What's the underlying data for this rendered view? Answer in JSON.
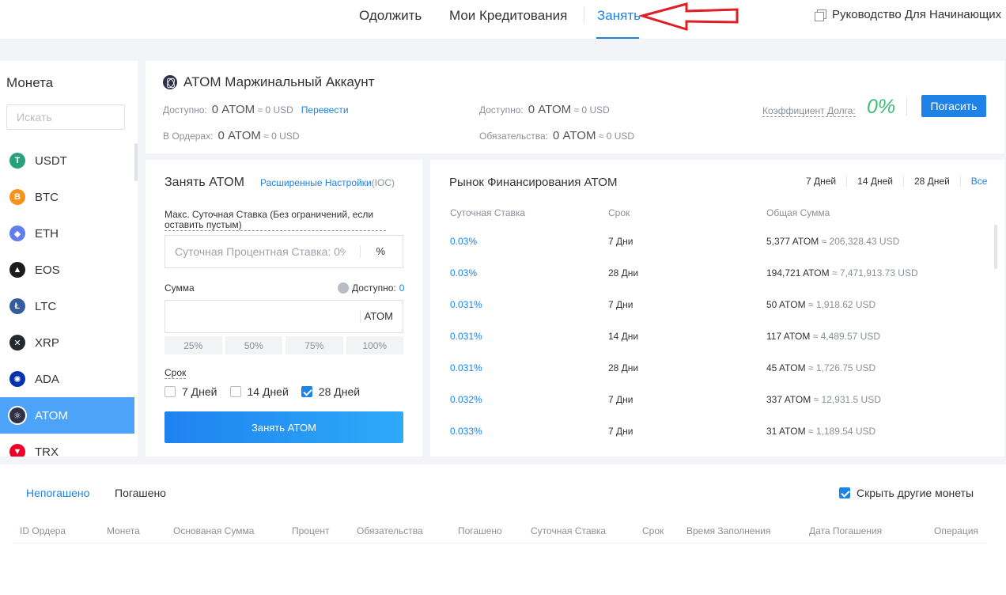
{
  "nav": {
    "tabs": [
      "Одолжить",
      "Мои Кредитования",
      "Занять"
    ],
    "guide": "Руководство Для Начинающих"
  },
  "sidebar": {
    "title": "Монета",
    "search_placeholder": "Искать",
    "coins": [
      {
        "name": "USDT",
        "color": "#26a17b",
        "glyph": "T"
      },
      {
        "name": "BTC",
        "color": "#f7931a",
        "glyph": "B"
      },
      {
        "name": "ETH",
        "color": "#627eea",
        "glyph": "◆"
      },
      {
        "name": "EOS",
        "color": "#1b1b1b",
        "glyph": "▲"
      },
      {
        "name": "LTC",
        "color": "#345d9d",
        "glyph": "Ł"
      },
      {
        "name": "XRP",
        "color": "#23292f",
        "glyph": "✕"
      },
      {
        "name": "ADA",
        "color": "#0033ad",
        "glyph": "✺"
      },
      {
        "name": "ATOM",
        "color": "#2e3148",
        "glyph": "⚛"
      },
      {
        "name": "TRX",
        "color": "#ef0027",
        "glyph": "▼"
      }
    ],
    "active": "ATOM"
  },
  "account": {
    "title": "ATOM Маржинальный Аккаунт",
    "available_label": "Доступно:",
    "available_value": "0 ATOM",
    "available_usd": "≈ 0 USD",
    "transfer": "Перевести",
    "in_orders_label": "В Ордерах:",
    "in_orders_value": "0 ATOM",
    "in_orders_usd": "≈ 0 USD",
    "available2_label": "Доступно:",
    "available2_value": "0 ATOM",
    "available2_usd": "≈ 0 USD",
    "liabilities_label": "Обязательства:",
    "liabilities_value": "0 ATOM",
    "liabilities_usd": "≈ 0 USD",
    "debt_ratio_label": "Коэффициент Долга:",
    "debt_ratio_value": "0%",
    "repay_button": "Погасить"
  },
  "borrow": {
    "title": "Занять ATOM",
    "advanced": "Расширенные Настройки",
    "advanced_suffix": "(IOC)",
    "max_rate_label": "Макс. Суточная Ставка (Без ограничений, если оставить пустым)",
    "rate_placeholder": "Суточная Процентная Ставка: 0%~",
    "rate_unit": "%",
    "amount_label": "Сумма",
    "available_label": "Доступно:",
    "available_value": "0",
    "amount_unit": "ATOM",
    "percents": [
      "25%",
      "50%",
      "75%",
      "100%"
    ],
    "term_label": "Срок",
    "terms": [
      {
        "label": "7 Дней",
        "checked": false
      },
      {
        "label": "14 Дней",
        "checked": false
      },
      {
        "label": "28 Дней",
        "checked": true
      }
    ],
    "submit": "Занять ATOM"
  },
  "market": {
    "title": "Рынок Финансирования ATOM",
    "filters": [
      "7 Дней",
      "14 Дней",
      "28 Дней",
      "Все"
    ],
    "columns": [
      "Суточная Ставка",
      "Срок",
      "Общая Сумма"
    ],
    "rows": [
      {
        "rate": "0.03%",
        "term": "7 Дни",
        "amount": "5,377 ATOM",
        "usd": "≈ 206,328.43 USD"
      },
      {
        "rate": "0.03%",
        "term": "28 Дни",
        "amount": "194,721 ATOM",
        "usd": "≈ 7,471,913.73 USD"
      },
      {
        "rate": "0.031%",
        "term": "7 Дни",
        "amount": "50 ATOM",
        "usd": "≈ 1,918.62 USD"
      },
      {
        "rate": "0.031%",
        "term": "14 Дни",
        "amount": "117 ATOM",
        "usd": "≈ 4,489.57 USD"
      },
      {
        "rate": "0.031%",
        "term": "28 Дни",
        "amount": "45 ATOM",
        "usd": "≈ 1,726.75 USD"
      },
      {
        "rate": "0.032%",
        "term": "7 Дни",
        "amount": "337 ATOM",
        "usd": "≈ 12,931.5 USD"
      },
      {
        "rate": "0.033%",
        "term": "7 Дни",
        "amount": "31 ATOM",
        "usd": "≈ 1,189.54 USD"
      }
    ]
  },
  "orders": {
    "tabs": [
      "Непогашено",
      "Погашено"
    ],
    "hide_other": "Скрыть другие монеты",
    "columns": [
      "ID Ордера",
      "Монета",
      "Основаная Сумма",
      "Процент",
      "Обязательства",
      "Погашено",
      "Суточная Ставка",
      "Срок",
      "Время Заполнения",
      "Дата Погашения",
      "Операция"
    ]
  }
}
